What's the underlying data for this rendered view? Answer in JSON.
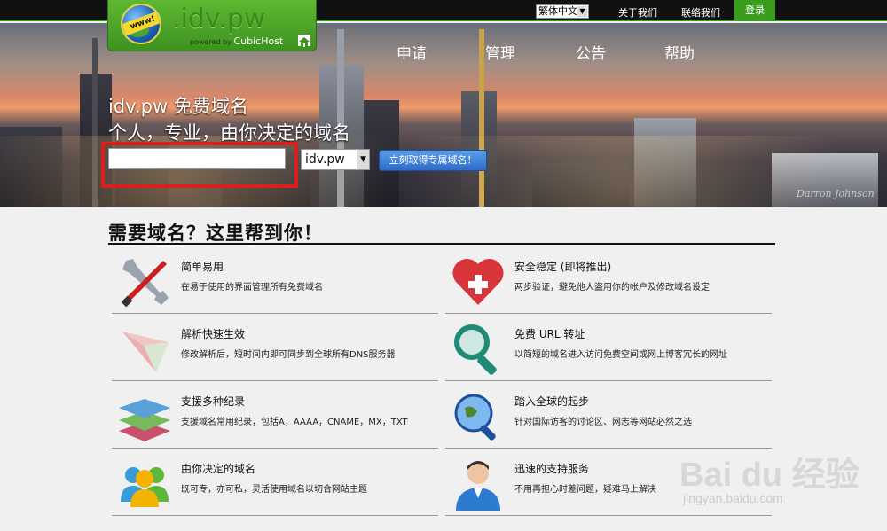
{
  "topbar": {
    "language": "繁体中文",
    "about_label": "关于我们",
    "contact_label": "联络我们",
    "login_label": "登录"
  },
  "logo": {
    "text": ".idv.pw",
    "globe_tag": "www!",
    "powered_prefix": "powered by",
    "powered_brand": "CubicHost"
  },
  "nav": {
    "items": [
      {
        "label": "申请"
      },
      {
        "label": "管理"
      },
      {
        "label": "公告"
      },
      {
        "label": "帮助"
      }
    ]
  },
  "hero": {
    "title": "idv.pw 免费域名",
    "subtitle": "个人，专业，由你决定的域名",
    "domain_input_value": "",
    "tld_selected": "idv.pw",
    "submit_label": "立刻取得专属域名！",
    "photo_credit": "Darron Johnson"
  },
  "features_section": {
    "title": "需要域名？这里帮到你！",
    "items": [
      {
        "title": "简单易用",
        "desc": "在易于使用的界面管理所有免费域名",
        "icon": "tools-icon"
      },
      {
        "title": "安全稳定 (即将推出)",
        "desc": "两步验证，避免他人盗用你的帐户及修改域名设定",
        "icon": "heart-plus-icon"
      },
      {
        "title": "解析快速生效",
        "desc": "修改解析后，短时间内即可同步到全球所有DNS服务器",
        "icon": "paper-plane-icon"
      },
      {
        "title": "免费 URL 转址",
        "desc": "以简短的域名进入访问免费空间或网上博客冗长的网址",
        "icon": "magnifier-icon"
      },
      {
        "title": "支援多种纪录",
        "desc": "支援域名常用纪录，包括A，AAAA，CNAME，MX，TXT",
        "icon": "layers-icon"
      },
      {
        "title": "踏入全球的起步",
        "desc": "针对国际访客的讨论区、网志等网站必然之选",
        "icon": "globe-search-icon"
      },
      {
        "title": "由你决定的域名",
        "desc": "既可专，亦可私，灵活使用域名以切合网站主题",
        "icon": "users-icon"
      },
      {
        "title": "迅速的支持服务",
        "desc": "不用再担心时差问题，疑难马上解决",
        "icon": "support-person-icon"
      }
    ]
  },
  "watermark": {
    "brand": "Bai du 经验",
    "url": "jingyan.baidu.com"
  },
  "colors": {
    "brand_green": "#3b9d1d",
    "button_blue": "#2d6ccb",
    "highlight_red": "#d9201f"
  }
}
